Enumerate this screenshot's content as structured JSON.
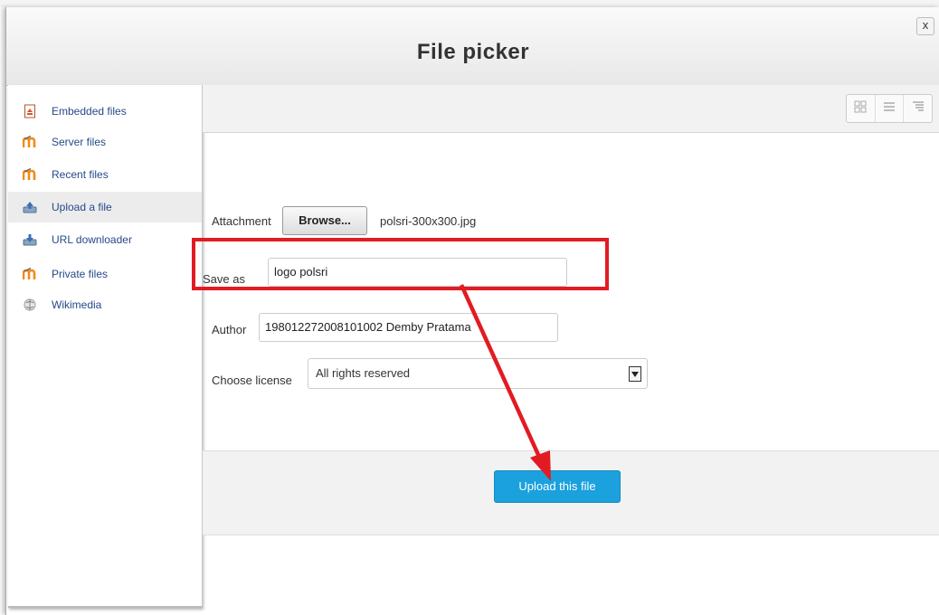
{
  "dialog": {
    "title": "File picker",
    "close_label": "x"
  },
  "sidebar": {
    "items": [
      {
        "label": "Embedded files",
        "icon": "embedded-file-icon"
      },
      {
        "label": "Server files",
        "icon": "moodle-icon"
      },
      {
        "label": "Recent files",
        "icon": "moodle-icon"
      },
      {
        "label": "Upload a file",
        "icon": "upload-icon",
        "active": true
      },
      {
        "label": "URL downloader",
        "icon": "url-download-icon"
      },
      {
        "label": "Private files",
        "icon": "moodle-icon"
      },
      {
        "label": "Wikimedia",
        "icon": "wikimedia-icon"
      }
    ]
  },
  "toolbar": {
    "view_buttons": [
      "icons-view-icon",
      "list-view-icon",
      "tree-view-icon"
    ]
  },
  "form": {
    "attachment_label": "Attachment",
    "browse_label": "Browse...",
    "file_name": "polsri-300x300.jpg",
    "save_as_label": "Save as",
    "save_as_value": "logo polsri",
    "author_label": "Author",
    "author_value": "198012272008101002 Demby Pratama",
    "license_label": "Choose license",
    "license_value": "All rights reserved"
  },
  "footer": {
    "upload_label": "Upload this file"
  },
  "colors": {
    "accent": "#1aa1de",
    "annotation": "#e21b22",
    "link": "#244a8a"
  }
}
